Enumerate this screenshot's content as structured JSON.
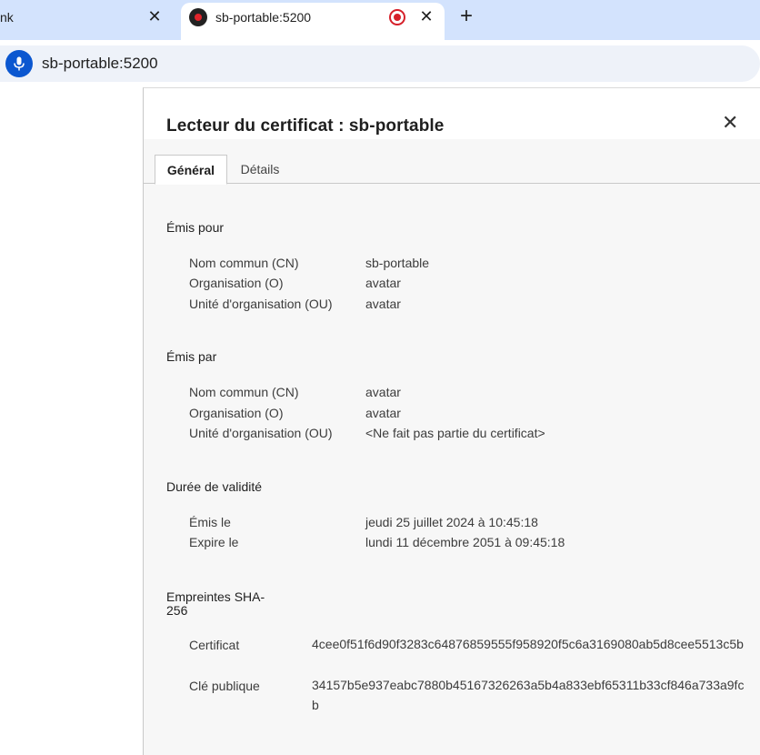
{
  "browser": {
    "tabs": [
      {
        "title": "nk"
      },
      {
        "title": "sb-portable:5200"
      }
    ],
    "close_glyph": "✕",
    "new_tab_glyph": "+",
    "address": "sb-portable:5200"
  },
  "dialog": {
    "title": "Lecteur du certificat : sb-portable",
    "close_glyph": "✕",
    "tabs": {
      "general": "Général",
      "details": "Détails"
    },
    "issued_to": {
      "title": "Émis pour",
      "rows": [
        {
          "label": "Nom commun (CN)",
          "value": "sb-portable"
        },
        {
          "label": "Organisation (O)",
          "value": "avatar"
        },
        {
          "label": "Unité d'organisation (OU)",
          "value": "avatar"
        }
      ]
    },
    "issued_by": {
      "title": "Émis par",
      "rows": [
        {
          "label": "Nom commun (CN)",
          "value": "avatar"
        },
        {
          "label": "Organisation (O)",
          "value": "avatar"
        },
        {
          "label": "Unité d'organisation (OU)",
          "value": "<Ne fait pas partie du certificat>"
        }
      ]
    },
    "validity": {
      "title": "Durée de validité",
      "rows": [
        {
          "label": "Émis le",
          "value": "jeudi 25 juillet 2024 à 10:45:18"
        },
        {
          "label": "Expire le",
          "value": "lundi 11 décembre 2051 à 09:45:18"
        }
      ]
    },
    "fingerprints": {
      "title": "Empreintes SHA-256",
      "rows": [
        {
          "label": "Certificat",
          "value": "4cee0f51f6d90f3283c64876859555f958920f5c6a3169080ab5d8cee5513c5b"
        },
        {
          "label": "Clé publique",
          "value": "34157b5e937eabc7880b45167326263a5b4a833ebf65311b33cf846a733a9fcb"
        }
      ]
    }
  },
  "colors": {
    "tabstrip_bg": "#d3e3fd",
    "omnibox_bg": "#eef2f9",
    "mic_bg": "#0b57d0",
    "record_red": "#d6202a",
    "dialog_bg": "#f7f7f7"
  },
  "icons": {
    "mic": "microphone-icon",
    "record": "recording-icon",
    "favicon": "site-favicon-icon"
  }
}
